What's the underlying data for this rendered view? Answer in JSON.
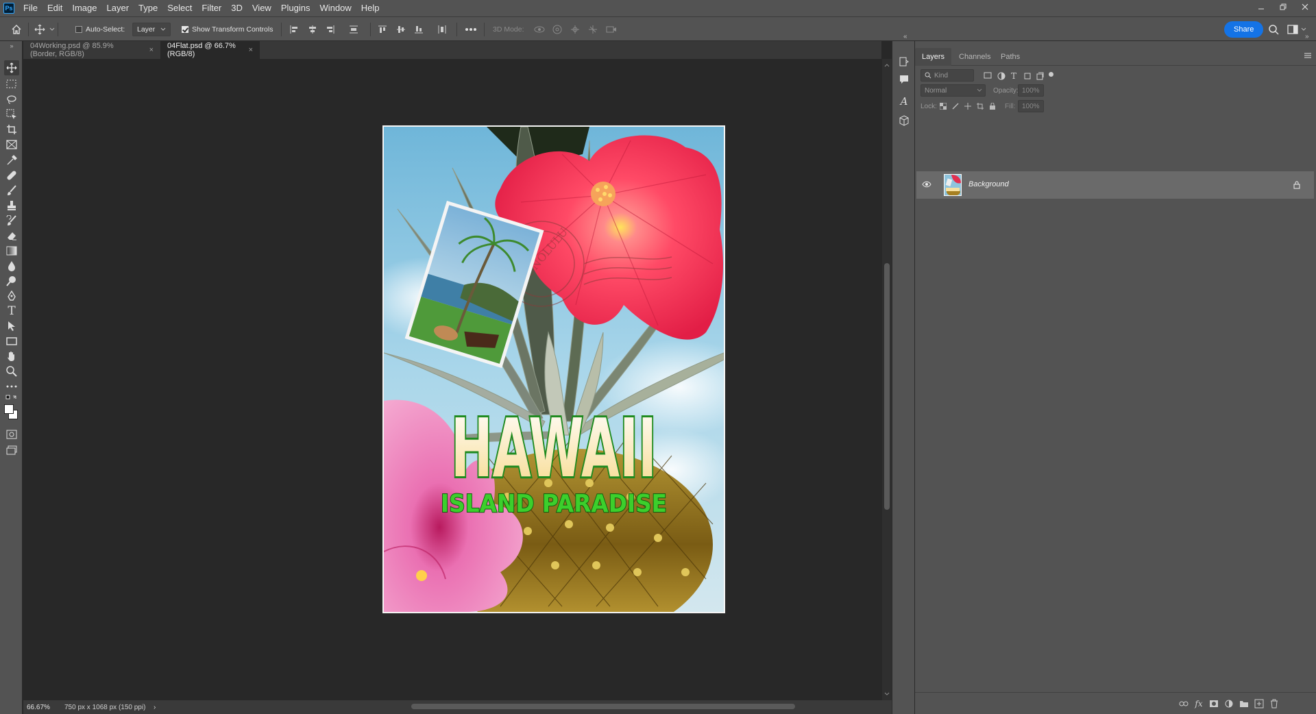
{
  "app": {
    "logo": "Ps",
    "menu": [
      "File",
      "Edit",
      "Image",
      "Layer",
      "Type",
      "Select",
      "Filter",
      "3D",
      "View",
      "Plugins",
      "Window",
      "Help"
    ]
  },
  "options": {
    "auto_select_label": "Auto-Select:",
    "auto_select_checked": false,
    "target_value": "Layer",
    "show_transform_label": "Show Transform Controls",
    "show_transform_checked": true,
    "mode_3d_label": "3D Mode:",
    "share_label": "Share"
  },
  "tabs": [
    {
      "label": "04Working.psd @ 85.9% (Border, RGB/8)",
      "close": "×",
      "active": false
    },
    {
      "label": "04Flat.psd @ 66.7% (RGB/8)",
      "close": "×",
      "active": true
    }
  ],
  "artwork": {
    "title": "HAWAII",
    "subtitle": "ISLAND PARADISE",
    "stamp_text": "HONOLULU"
  },
  "status": {
    "zoom": "66.67%",
    "doc_size": "750 px x 1068 px (150 ppi)",
    "arrow": "›"
  },
  "panel": {
    "tabs": [
      "Layers",
      "Channels",
      "Paths"
    ],
    "filter_placeholder": "Kind",
    "blend_mode": "Normal",
    "opacity_label": "Opacity:",
    "opacity_value": "100%",
    "lock_label": "Lock:",
    "fill_label": "Fill:",
    "fill_value": "100%",
    "layers": [
      {
        "name": "Background",
        "visible": true,
        "locked": true
      }
    ]
  },
  "colors": {
    "ui_dark": "#282828",
    "ui_panel": "#535353",
    "accent": "#1473e6",
    "title_fill": "#fff6cf",
    "title_stroke": "#1e8a1e",
    "subtitle_fill": "#3ccf2c"
  }
}
